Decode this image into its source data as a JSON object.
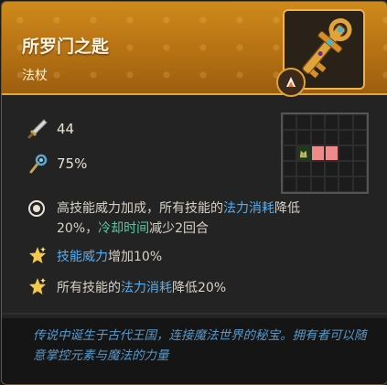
{
  "item": {
    "name": "所罗门之匙",
    "type": "法杖"
  },
  "stats": {
    "attack": "44",
    "crit_rate": "75%"
  },
  "effects": {
    "main": {
      "prefix": "高技能威力加成，所有技能的",
      "highlight1": "法力消耗",
      "mid": "降低",
      "line2_start": "20%，",
      "highlight2": "冷却时间",
      "line2_end": "减少2回合"
    },
    "star1": {
      "highlight": "技能威力",
      "rest": "增加10%"
    },
    "star2": {
      "prefix": "所有技能的",
      "highlight": "法力消耗",
      "rest": "降低20%"
    }
  },
  "lore": "传说中诞生于古代王国，连接魔法世界的秘宝。拥有者可以随意掌控元素与魔法的力量",
  "range_grid": {
    "cols": 6,
    "rows": 5,
    "player_cell": [
      1,
      2
    ],
    "target_cells": [
      [
        2,
        2
      ],
      [
        3,
        2
      ]
    ]
  },
  "colors": {
    "header": "#c47f18",
    "highlight_blue": "#53aef3",
    "highlight_green": "#59c9a5",
    "target": "#f08a8a"
  },
  "icons": {
    "attack": "sword-icon",
    "crit": "staff-icon",
    "effect": "ring-icon",
    "bonus": "star-icon",
    "element": "fire-icon"
  }
}
